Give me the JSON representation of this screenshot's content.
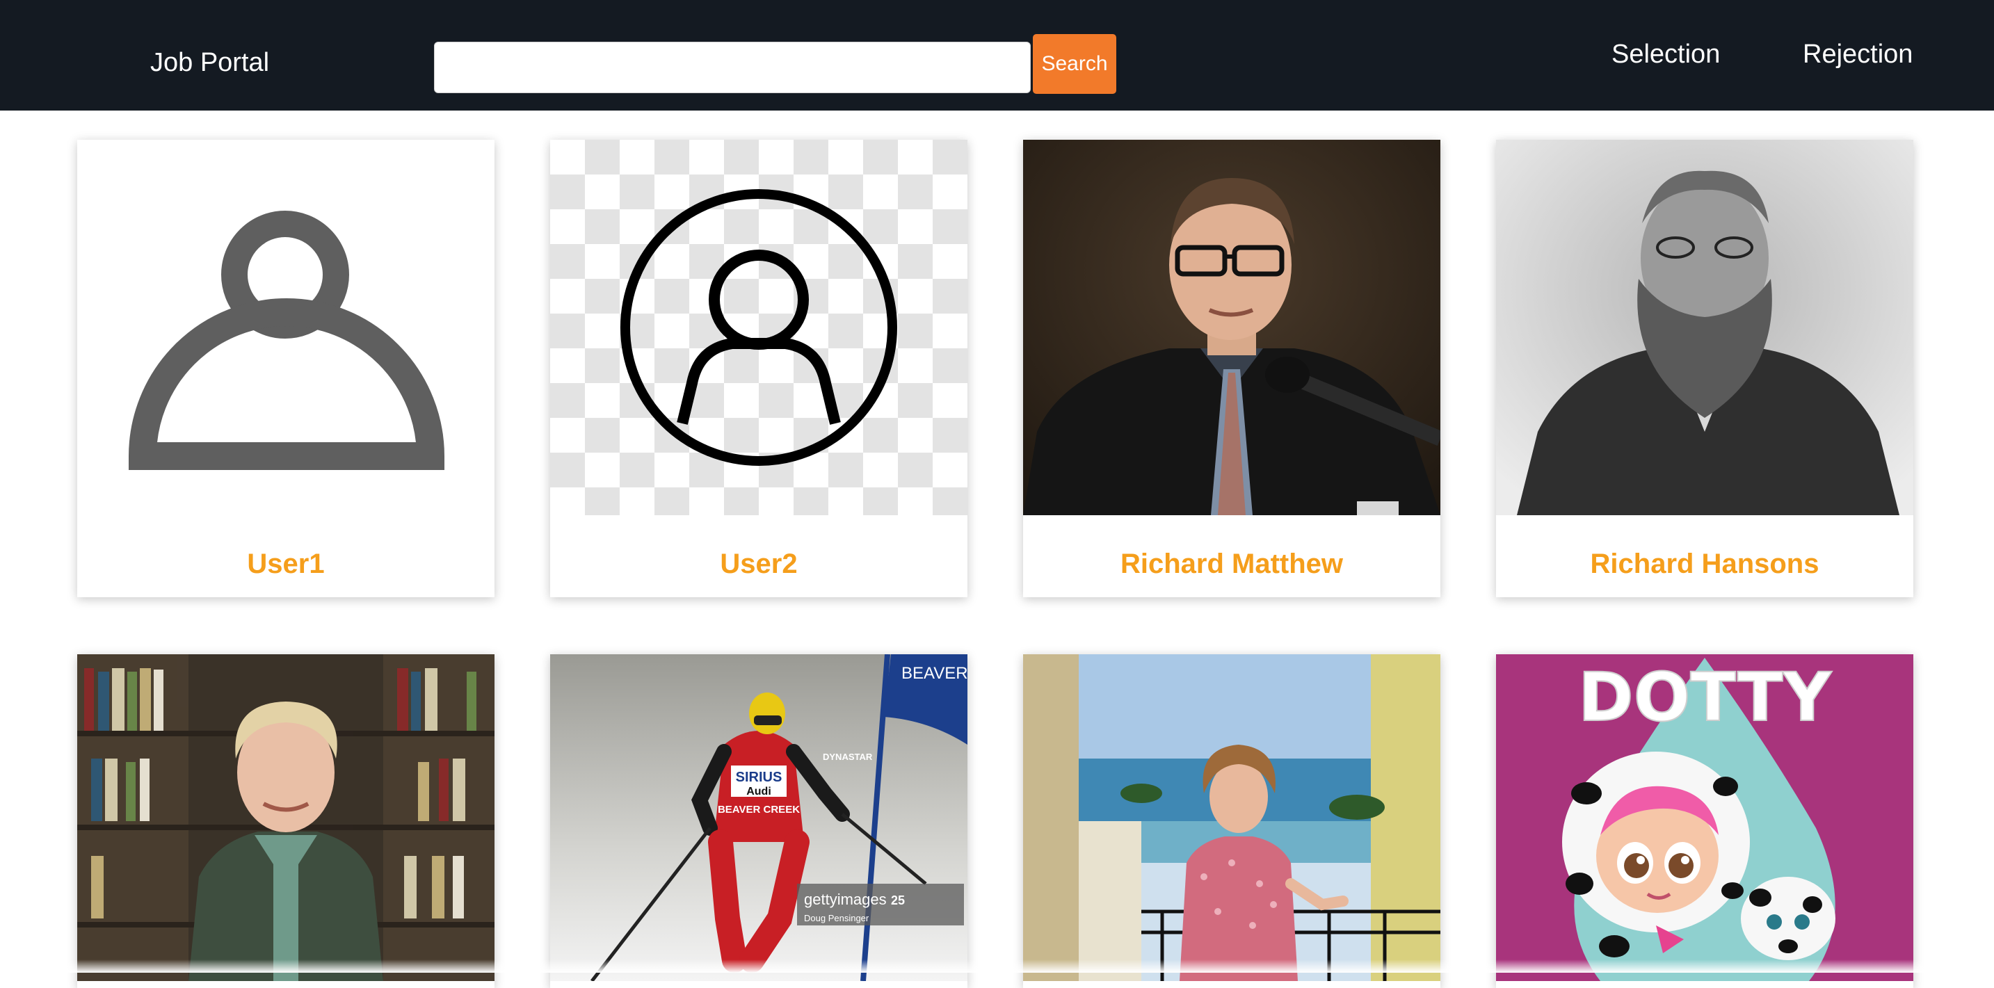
{
  "navbar": {
    "brand": "Job Portal",
    "search": {
      "value": "",
      "placeholder": "",
      "button_label": "Search"
    },
    "links": {
      "selection": "Selection",
      "rejection": "Rejection"
    }
  },
  "candidates": [
    {
      "name": "User1",
      "photo": "generic-avatar-icon"
    },
    {
      "name": "User2",
      "photo": "avatar-circle-outline-icon"
    },
    {
      "name": "Richard Matthew",
      "photo": "portrait-man-glasses-microphone"
    },
    {
      "name": "Richard Hansons",
      "photo": "vintage-portrait-bearded-man"
    },
    {
      "name": "",
      "photo": "woman-in-library"
    },
    {
      "name": "",
      "photo": "skier-racing"
    },
    {
      "name": "",
      "photo": "woman-on-balcony-by-sea"
    },
    {
      "name": "",
      "photo": "dotty-doll-illustration"
    }
  ],
  "photo_texts": {
    "dotty": "DOTTY",
    "skier_bib": "SIRIUS",
    "skier_bib_brand": "Audi",
    "skier_bib_event": "BEAVER CREEK",
    "skier_helmet": "DYNASTAR",
    "flag_text": "BEAVER CRE",
    "watermark": "gettyimages",
    "watermark_credit": "Doug Pensinger",
    "watermark_tag": "25"
  },
  "colors": {
    "navbar_bg": "#141a22",
    "search_button": "#f27a2a",
    "candidate_name": "#f59e1b"
  }
}
